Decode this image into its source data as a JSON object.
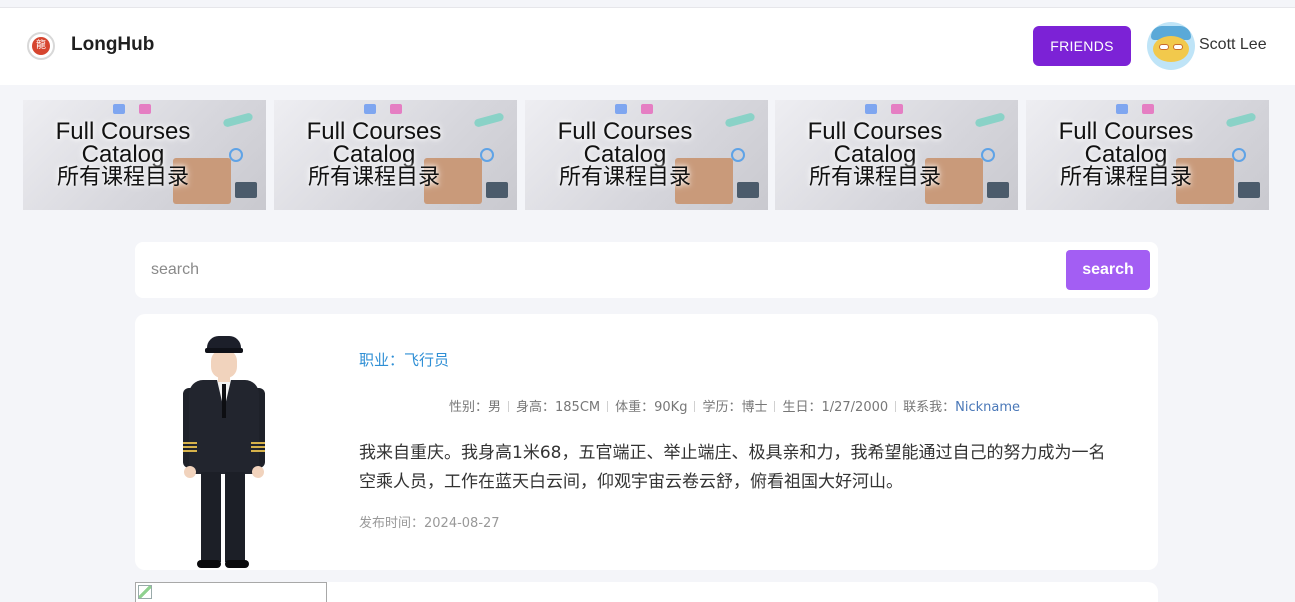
{
  "header": {
    "brand": "LongHub",
    "friends_button": "FRIENDS",
    "username": "Scott Lee",
    "logo_icon": "brand-logo-icon",
    "avatar_icon": "user-avatar"
  },
  "banners": [
    {
      "line1": "Full Courses",
      "line2": "Catalog",
      "line3": "所有课程目录"
    },
    {
      "line1": "Full Courses",
      "line2": "Catalog",
      "line3": "所有课程目录"
    },
    {
      "line1": "Full Courses",
      "line2": "Catalog",
      "line3": "所有课程目录"
    },
    {
      "line1": "Full Courses",
      "line2": "Catalog",
      "line3": "所有课程目录"
    },
    {
      "line1": "Full Courses",
      "line2": "Catalog",
      "line3": "所有课程目录"
    }
  ],
  "search": {
    "placeholder": "search",
    "value": "",
    "button": "search"
  },
  "profile": {
    "job": "职业：飞行员",
    "meta": [
      {
        "label": "性别：男"
      },
      {
        "label": "身高：185CM"
      },
      {
        "label": "体重：90Kg"
      },
      {
        "label": "学历：博士"
      },
      {
        "label": "生日：1/27/2000"
      }
    ],
    "contact_label": "联系我：",
    "contact_link": "Nickname",
    "description": "我来自重庆。我身高1米68，五官端正、举止端庄、极具亲和力，我希望能通过自己的努力成为一名空乘人员，工作在蓝天白云间，仰观宇宙云卷云舒，俯看祖国大好河山。",
    "date": "发布时间：2024-08-27"
  },
  "colors": {
    "accent": "#7c22d6",
    "search_button": "#a35ef3",
    "link": "#2f8fd5",
    "background": "#f4f5f9"
  }
}
